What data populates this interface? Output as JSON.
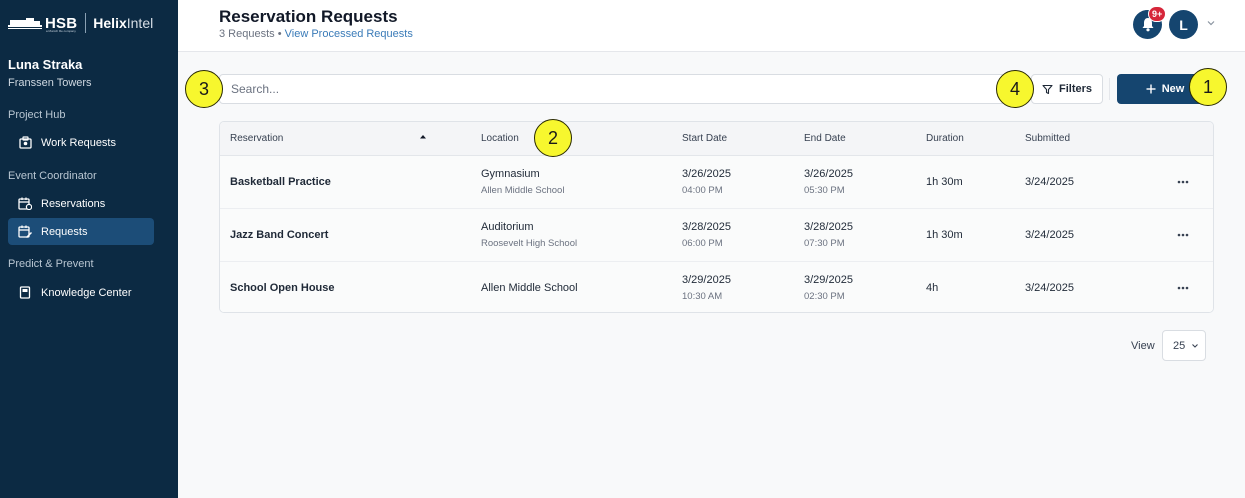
{
  "sidebar": {
    "brand": {
      "hsb": "HSB",
      "hsb_sub": "a Munich Re company",
      "helix_bold": "Helix",
      "helix_light": "Intel"
    },
    "user": {
      "name": "Luna Straka",
      "org": "Franssen Towers"
    },
    "sections": [
      {
        "label": "Project Hub",
        "items": [
          {
            "label": "Work Requests",
            "icon": "work-requests-icon"
          }
        ]
      },
      {
        "label": "Event Coordinator",
        "items": [
          {
            "label": "Reservations",
            "icon": "calendar-icon"
          },
          {
            "label": "Requests",
            "icon": "calendar-edit-icon",
            "active": true
          }
        ]
      },
      {
        "label": "Predict & Prevent",
        "items": [
          {
            "label": "Knowledge Center",
            "icon": "book-icon"
          }
        ]
      }
    ]
  },
  "header": {
    "title": "Reservation Requests",
    "count_text": "3 Requests",
    "separator": "•",
    "link_text": "View Processed Requests",
    "notification_badge": "9+",
    "avatar_initial": "L"
  },
  "toolbar": {
    "search_placeholder": "Search...",
    "filters_label": "Filters",
    "new_label": "New"
  },
  "table": {
    "columns": [
      "Reservation",
      "Location",
      "Start Date",
      "End Date",
      "Duration",
      "Submitted"
    ],
    "rows": [
      {
        "reservation": "Basketball Practice",
        "location": "Gymnasium",
        "location_sub": "Allen Middle School",
        "start_date": "3/26/2025",
        "start_time": "04:00 PM",
        "end_date": "3/26/2025",
        "end_time": "05:30 PM",
        "duration": "1h 30m",
        "submitted": "3/24/2025"
      },
      {
        "reservation": "Jazz Band Concert",
        "location": "Auditorium",
        "location_sub": "Roosevelt High School",
        "start_date": "3/28/2025",
        "start_time": "06:00 PM",
        "end_date": "3/28/2025",
        "end_time": "07:30 PM",
        "duration": "1h 30m",
        "submitted": "3/24/2025"
      },
      {
        "reservation": "School Open House",
        "location": "Allen Middle School",
        "location_sub": "",
        "start_date": "3/29/2025",
        "start_time": "10:30 AM",
        "end_date": "3/29/2025",
        "end_time": "02:30 PM",
        "duration": "4h",
        "submitted": "3/24/2025"
      }
    ]
  },
  "pager": {
    "view_label": "View",
    "page_size": "25"
  },
  "callouts": [
    "1",
    "2",
    "3",
    "4"
  ],
  "colors": {
    "sidebar_bg": "#0c2a43",
    "accent": "#15456f",
    "active_nav": "#1c4d78",
    "badge": "#d6263a",
    "link": "#3a7bb8",
    "callout": "#f7f72e"
  }
}
